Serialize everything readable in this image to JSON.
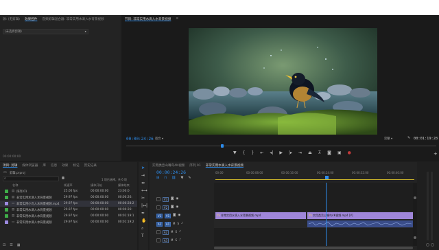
{
  "source_panel": {
    "tabs": [
      "源: (无剪辑)",
      "效果控件",
      "音频剪辑混合器: 非常实用水滴入水背景视频"
    ],
    "active_tab": 1,
    "clip_field": "(未选择剪辑)",
    "timecode": "00:00:00:00"
  },
  "program_monitor": {
    "title": "节目: 非常实用水滴入水背景视频",
    "current_timecode": "00:00:24:26",
    "fit_label": "适合",
    "quality_label": "完整",
    "duration_timecode": "00:01:19:28"
  },
  "project_panel": {
    "tabs": [
      "项目: 剪辑",
      "媒体浏览器",
      "库",
      "信息",
      "效果",
      "标记",
      "历史记录"
    ],
    "active_tab": 0,
    "project_file": "剪辑.prproj",
    "selection_info": "1 项已选择，共 6 项",
    "columns": [
      "名称",
      "帧速率",
      "媒体开始",
      "媒体结束"
    ],
    "items": [
      {
        "name": "序列 01",
        "fps": "25.00 fps",
        "start": "00:00:00:00",
        "end": "23:00:0",
        "color": "#3fae49"
      },
      {
        "name": "非常实用水滴入水背景视频",
        "fps": "29.97 fps",
        "start": "00:00:00:00",
        "end": "00:00:26:",
        "color": "#3fae49"
      },
      {
        "name": "非常实用小鸟入水背景视频.mp4",
        "fps": "29.97 fps",
        "start": "00:00:00:00",
        "end": "00:00:28:2",
        "color": "#9c8ae0"
      },
      {
        "name": "非常实用水滴入水背景视频",
        "fps": "29.97 fps",
        "start": "00:00:00:00",
        "end": "00:00:26:",
        "color": "#3fae49"
      },
      {
        "name": "非常实用水滴入水背景视频",
        "fps": "29.97 fps",
        "start": "00:00:00:00",
        "end": "00:01:19:1",
        "color": "#3fae49"
      },
      {
        "name": "非常实用水滴入水背景视频",
        "fps": "29.97 fps",
        "start": "00:00:00:00",
        "end": "00:01:19:2",
        "color": "#9c8ae0"
      }
    ]
  },
  "timeline": {
    "tabs": [
      "实用类舌山嘴鸟4K视频",
      "序列 01",
      "非常实用水滴入水背景视频"
    ],
    "active_tab": 2,
    "timecode": "00:00:24:26",
    "ruler": [
      "00:00",
      "00:00:08:00",
      "00:00:16:00",
      "00:00:24:00",
      "00:00:32:00",
      "00:00:40:00"
    ],
    "tracks": [
      "V3",
      "V2",
      "V1",
      "A1",
      "A2",
      "A3"
    ],
    "track_targets": {
      "V1": "V1",
      "A1": "A1"
    },
    "clips": {
      "v1_a": "非常实用水滴入水背景视频.mp4",
      "v1_b": "实用类舌山嘴鸟4K视频.mp4 [V]"
    }
  },
  "tools": [
    "selection-tool",
    "track-select-tool",
    "ripple-edit-tool",
    "razor-tool",
    "slip-tool",
    "pen-tool",
    "hand-tool",
    "type-tool"
  ],
  "colors": {
    "accent": "#2d8ceb",
    "video_clip": "#9f86d9",
    "audio_clip": "#3a4d8a",
    "playhead": "#2d8ceb"
  }
}
